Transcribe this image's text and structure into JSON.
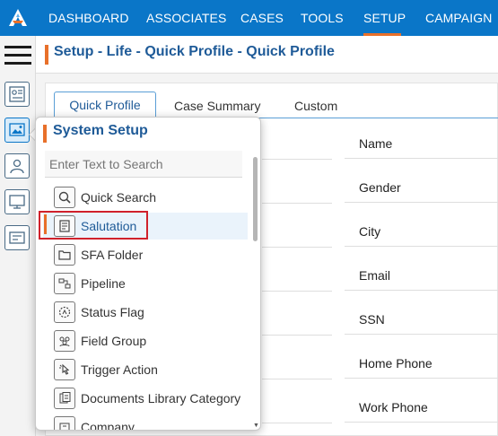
{
  "nav": {
    "items": [
      "DASHBOARD",
      "ASSOCIATES",
      "CASES",
      "TOOLS",
      "SETUP",
      "CAMPAIGN"
    ],
    "active": "SETUP",
    "accent_color": "#e8702a",
    "bar_color": "#0a76c8"
  },
  "rail": {
    "icons": [
      "menu-icon",
      "profile-settings-icon",
      "image-config-icon",
      "user-icon",
      "monitor-icon",
      "cards-icon"
    ]
  },
  "breadcrumb": {
    "title": "Setup - Life - Quick Profile - Quick Profile"
  },
  "tabs": [
    "Quick Profile",
    "Case Summary",
    "Custom"
  ],
  "fields": [
    "Name",
    "Gender",
    "City",
    "Email",
    "SSN",
    "Home Phone",
    "Work Phone"
  ],
  "popover": {
    "title": "System Setup",
    "search_placeholder": "Enter Text to Search",
    "items": [
      {
        "label": "Quick Search",
        "icon": "search-icon"
      },
      {
        "label": "Salutation",
        "icon": "document-icon",
        "selected": true
      },
      {
        "label": "SFA Folder",
        "icon": "folder-icon"
      },
      {
        "label": "Pipeline",
        "icon": "pipeline-icon"
      },
      {
        "label": "Status Flag",
        "icon": "status-flag-icon"
      },
      {
        "label": "Field Group",
        "icon": "group-icon"
      },
      {
        "label": "Trigger Action",
        "icon": "pointer-icon"
      },
      {
        "label": "Documents Library Category",
        "icon": "library-icon"
      },
      {
        "label": "Company",
        "icon": "company-icon"
      }
    ]
  }
}
